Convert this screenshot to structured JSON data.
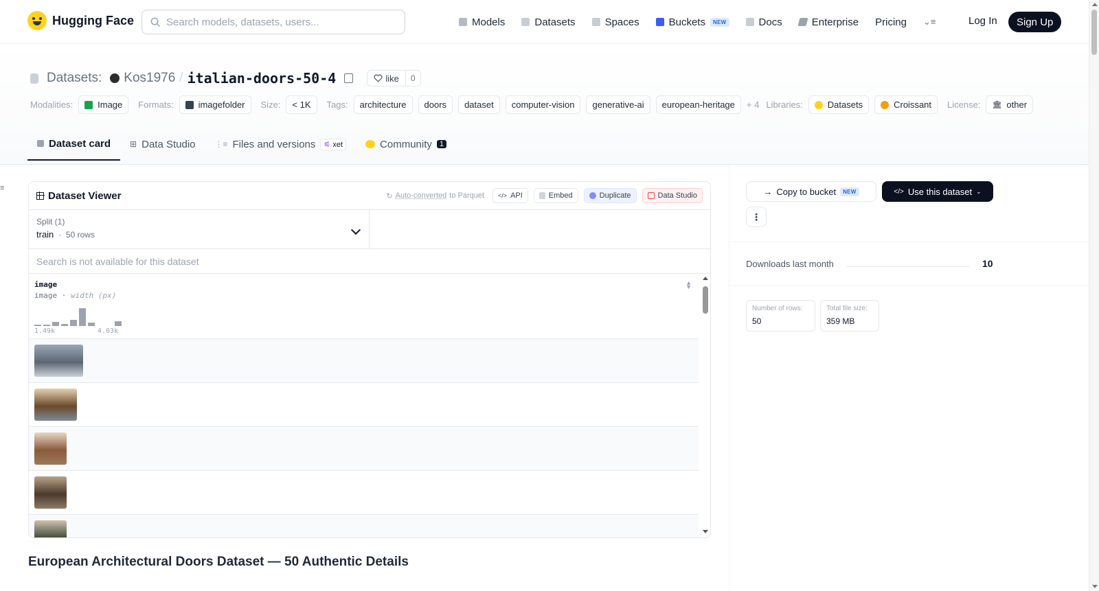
{
  "header": {
    "brand": "Hugging Face",
    "search_placeholder": "Search models, datasets, users...",
    "nav": [
      {
        "label": "Models",
        "icon": "cube-icon",
        "color": "#9ca3af"
      },
      {
        "label": "Datasets",
        "icon": "database-icon",
        "color": "#9ca3af"
      },
      {
        "label": "Spaces",
        "icon": "spaces-icon",
        "color": "#9ca3af"
      },
      {
        "label": "Buckets",
        "icon": "bucket-icon",
        "color": "#3b5bfd",
        "badge": "NEW"
      },
      {
        "label": "Docs",
        "icon": "book-icon",
        "color": "#9ca3af"
      },
      {
        "label": "Enterprise",
        "icon": "enterprise-icon",
        "color": "#9ca3af"
      },
      {
        "label": "Pricing"
      }
    ],
    "login": "Log In",
    "signup": "Sign Up"
  },
  "title": {
    "prefix": "Datasets:",
    "user": "Kos1976",
    "separator": "/",
    "name": "italian-doors-50-4",
    "like_label": "like",
    "like_count": "0"
  },
  "meta": {
    "modalities_label": "Modalities:",
    "modality": "Image",
    "formats_label": "Formats:",
    "format": "imagefolder",
    "size_label": "Size:",
    "size": "< 1K",
    "tags_label": "Tags:",
    "tags": [
      "architecture",
      "doors",
      "dataset",
      "computer-vision",
      "generative-ai",
      "european-heritage"
    ],
    "more_tags": "+ 4",
    "libraries_label": "Libraries:",
    "libraries": [
      "Datasets",
      "Croissant"
    ],
    "license_label": "License:",
    "license": "other"
  },
  "tabs": [
    {
      "label": "Dataset card",
      "active": true
    },
    {
      "label": "Data Studio"
    },
    {
      "label": "Files and versions",
      "badge": "xet"
    },
    {
      "label": "Community",
      "count": "1"
    }
  ],
  "viewer": {
    "title": "Dataset Viewer",
    "auto_converted_prefix": "Auto-converted",
    "auto_converted_suffix": " to Parquet",
    "api": "API",
    "embed": "Embed",
    "duplicate": "Duplicate",
    "data_studio": "Data Studio",
    "split_label": "Split (1)",
    "split_value": "train",
    "split_rows": "50 rows",
    "search_disabled": "Search is not available for this dataset",
    "column": {
      "name": "image",
      "type": "image",
      "subtype": "width (px)",
      "min": "1.49k",
      "max": "4.03k",
      "histogram": [
        0.04,
        0.04,
        0.25,
        0.12,
        0.35,
        1.0,
        0.18,
        0,
        0,
        0.28
      ]
    },
    "thumbnails": [
      {
        "width": 71,
        "colors": [
          "#9aa7b7",
          "#5d6672",
          "#c9d1da"
        ]
      },
      {
        "width": 62,
        "colors": [
          "#e4d2b3",
          "#6b4a2b",
          "#7d8a98"
        ]
      },
      {
        "width": 47,
        "colors": [
          "#e7d8c6",
          "#8a5a3c",
          "#9b7a5a"
        ]
      },
      {
        "width": 47,
        "colors": [
          "#b9a48a",
          "#4b3a2c",
          "#8c7a66"
        ]
      },
      {
        "width": 47,
        "colors": [
          "#cfc2ae",
          "#3f4a3a",
          "#a08c74"
        ]
      }
    ]
  },
  "readme": {
    "heading": "European Architectural Doors Dataset — 50 Authentic Details"
  },
  "sidebar": {
    "copy_to_bucket": "Copy to bucket",
    "copy_badge": "NEW",
    "use_dataset": "Use this dataset",
    "downloads_label": "Downloads last month",
    "downloads_value": "10",
    "rows_label": "Number of rows:",
    "rows_value": "50",
    "size_label": "Total file size:",
    "size_value": "359 MB"
  },
  "colors": {
    "accent_dark": "#0b1120",
    "new_badge": "#2563eb",
    "yellow_brand": "#ffd21e"
  }
}
